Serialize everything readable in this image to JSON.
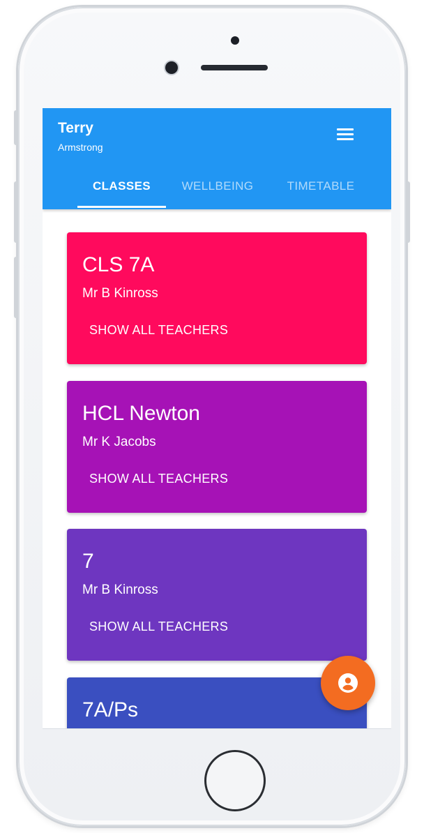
{
  "user": {
    "first_name": "Terry",
    "last_name": "Armstrong"
  },
  "tabs": [
    {
      "label": "CLASSES",
      "active": true
    },
    {
      "label": "WELLBEING",
      "active": false
    },
    {
      "label": "TIMETABLE",
      "active": false
    }
  ],
  "classes": [
    {
      "title": "CLS 7A",
      "teacher": "Mr B Kinross",
      "action": "SHOW ALL TEACHERS",
      "color": "#ff0a5d"
    },
    {
      "title": "HCL Newton",
      "teacher": "Mr K Jacobs",
      "action": "SHOW ALL TEACHERS",
      "color": "#a612b6"
    },
    {
      "title": "7",
      "teacher": "Mr B Kinross",
      "action": "SHOW ALL TEACHERS",
      "color": "#6e36c0"
    },
    {
      "title": "7A/Ps",
      "color": "#3a4fc0"
    }
  ],
  "colors": {
    "appbar": "#2196f3",
    "fab": "#f36c21"
  },
  "icons": {
    "menu": "hamburger-menu-icon",
    "fab": "account-circle-icon"
  }
}
